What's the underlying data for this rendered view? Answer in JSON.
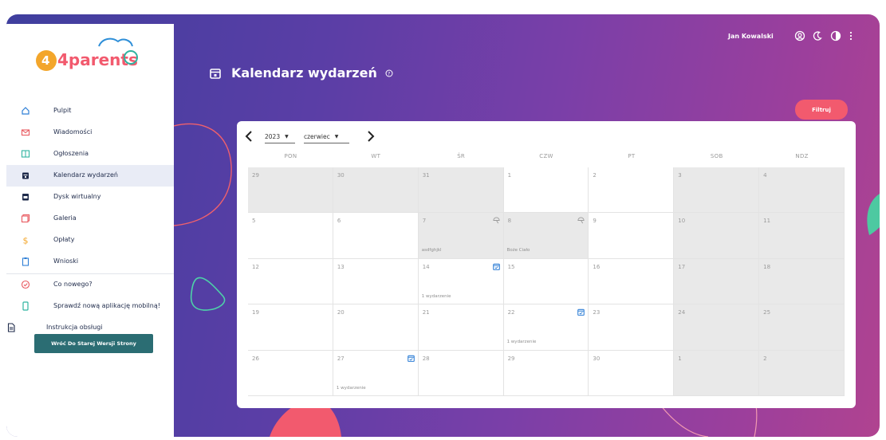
{
  "app": {
    "logo_text": "4parents"
  },
  "header": {
    "title": "Kalendarz wydarzeń",
    "user_name": "Jan Kowalski",
    "filter_label": "Filtruj"
  },
  "sidebar": {
    "items": [
      {
        "label": "Pulpit",
        "icon": "home-icon"
      },
      {
        "label": "Wiadomości",
        "icon": "mail-icon"
      },
      {
        "label": "Ogłoszenia",
        "icon": "announcement-icon"
      },
      {
        "label": "Kalendarz wydarzeń",
        "icon": "calendar-icon",
        "active": true
      },
      {
        "label": "Dysk wirtualny",
        "icon": "drive-icon"
      },
      {
        "label": "Galeria",
        "icon": "gallery-icon"
      },
      {
        "label": "Opłaty",
        "icon": "dollar-icon"
      },
      {
        "label": "Wnioski",
        "icon": "clipboard-icon"
      }
    ],
    "extra_items": [
      {
        "label": "Co nowego?",
        "icon": "whats-new-icon"
      },
      {
        "label": "Sprawdź nową aplikację mobilną!",
        "icon": "mobile-icon"
      },
      {
        "label": "Instrukcja obsługi",
        "icon": "document-icon"
      }
    ],
    "old_version_label": "Wróć Do Starej Wersji Strony"
  },
  "calendar": {
    "year": "2023",
    "month": "czerwiec",
    "weekdays": [
      "PON",
      "WT",
      "ŚR",
      "CZW",
      "PT",
      "SOB",
      "NDZ"
    ],
    "weeks": [
      [
        {
          "day": "29",
          "gray": true
        },
        {
          "day": "30",
          "gray": true
        },
        {
          "day": "31",
          "gray": true
        },
        {
          "day": "1"
        },
        {
          "day": "2"
        },
        {
          "day": "3",
          "gray": true
        },
        {
          "day": "4",
          "gray": true
        }
      ],
      [
        {
          "day": "5"
        },
        {
          "day": "6"
        },
        {
          "day": "7",
          "gray": true,
          "note": "asdfghjkl",
          "icon": "holiday-icon"
        },
        {
          "day": "8",
          "gray": true,
          "note": "Boże Ciało",
          "icon": "holiday-icon"
        },
        {
          "day": "9"
        },
        {
          "day": "10",
          "gray": true
        },
        {
          "day": "11",
          "gray": true
        }
      ],
      [
        {
          "day": "12"
        },
        {
          "day": "13"
        },
        {
          "day": "14",
          "note": "1 wydarzenie",
          "icon": "event-icon"
        },
        {
          "day": "15"
        },
        {
          "day": "16"
        },
        {
          "day": "17",
          "gray": true
        },
        {
          "day": "18",
          "gray": true
        }
      ],
      [
        {
          "day": "19"
        },
        {
          "day": "20"
        },
        {
          "day": "21"
        },
        {
          "day": "22",
          "note": "1 wydarzenie",
          "icon": "event-icon"
        },
        {
          "day": "23"
        },
        {
          "day": "24",
          "gray": true
        },
        {
          "day": "25",
          "gray": true
        }
      ],
      [
        {
          "day": "26"
        },
        {
          "day": "27",
          "note": "1 wydarzenie",
          "icon": "event-icon"
        },
        {
          "day": "28"
        },
        {
          "day": "29"
        },
        {
          "day": "30"
        },
        {
          "day": "1",
          "gray": true
        },
        {
          "day": "2",
          "gray": true
        }
      ]
    ]
  },
  "colors": {
    "accent": "#f25a6e",
    "teal": "#2b6d73",
    "icon_red": "#e8595f",
    "event_blue": "#2f7fd6"
  }
}
